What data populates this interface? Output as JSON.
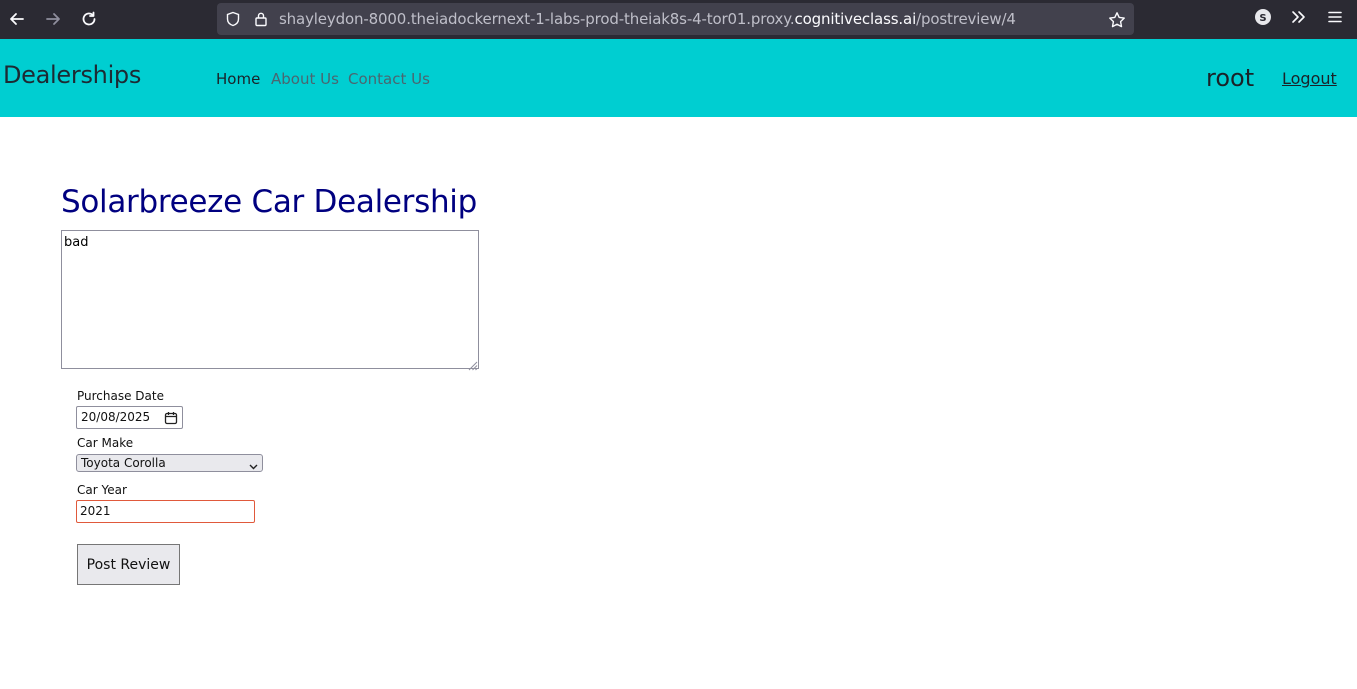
{
  "browser": {
    "url_prefix": "shayleydon-8000.theiadockernext-1-labs-prod-theiak8s-4-tor01.proxy.",
    "url_domain": "cognitiveclass.ai",
    "url_path": "/postreview/4",
    "icons": [
      "back-arrow-icon",
      "forward-arrow-icon",
      "reload-icon",
      "shield-icon",
      "lock-icon",
      "star-icon",
      "account-icon",
      "overflow-icon",
      "menu-icon"
    ],
    "account_initial": "S"
  },
  "navbar": {
    "brand": "Dealerships",
    "links": [
      "Home",
      "About Us",
      "Contact Us"
    ],
    "username": "root",
    "logout": "Logout",
    "background": "#00ced1"
  },
  "main": {
    "dealer_name": "Solarbreeze Car Dealership",
    "review_text": "bad",
    "purchase_date_label": "Purchase Date",
    "purchase_date": {
      "day": "20",
      "month": "08",
      "year": "2025"
    },
    "car_make_label": "Car Make",
    "car_make_selected": "Toyota Corolla",
    "car_year_label": "Car Year",
    "car_year": "2021",
    "submit_label": "Post Review",
    "title_color": "#000080"
  }
}
